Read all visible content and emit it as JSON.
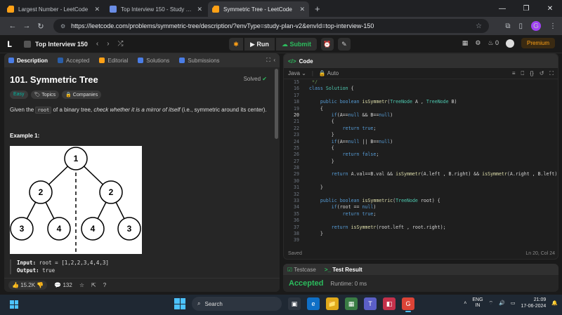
{
  "browser": {
    "tabs": [
      {
        "title": "Largest Number - LeetCode",
        "favicon": "leetcode-icon"
      },
      {
        "title": "Top Interview 150 - Study Plan",
        "favicon": "book-icon"
      },
      {
        "title": "Symmetric Tree - LeetCode",
        "favicon": "leetcode-icon",
        "active": true
      }
    ],
    "new_tab": "+",
    "url": "https://leetcode.com/problems/symmetric-tree/description/?envType=study-plan-v2&envId=top-interview-150",
    "profile_initial": "G"
  },
  "lc_nav": {
    "list_title": "Top Interview 150",
    "run_label": "Run",
    "submit_label": "Submit",
    "streak_count": "0",
    "premium_label": "Premium"
  },
  "left": {
    "tabs": [
      "Description",
      "Accepted",
      "Editorial",
      "Solutions",
      "Submissions"
    ],
    "title": "101. Symmetric Tree",
    "solved": "Solved",
    "tags": [
      "Easy",
      "Topics",
      "Companies"
    ],
    "desc_pre": "Given the ",
    "desc_code": "root",
    "desc_mid": " of a binary tree, ",
    "desc_em": "check whether it is a mirror of itself",
    "desc_post": " (i.e., symmetric around its center).",
    "example_title": "Example 1:",
    "tree_nodes": [
      "1",
      "2",
      "2",
      "3",
      "4",
      "4",
      "3"
    ],
    "input_label": "Input:",
    "input_value": "root = [1,2,2,3,4,4,3]",
    "output_label": "Output:",
    "output_value": "true",
    "likes": "15.2K",
    "comments": "132"
  },
  "right": {
    "header": "Code",
    "language": "Java",
    "mode": "Auto",
    "saved": "Saved",
    "cursor": "Ln 20, Col 24",
    "code_lines": [
      {
        "n": "15",
        "t": " */"
      },
      {
        "n": "16",
        "t": "class Solution {"
      },
      {
        "n": "17",
        "t": ""
      },
      {
        "n": "18",
        "t": "    public boolean isSymmetr(TreeNode A , TreeNode B)"
      },
      {
        "n": "19",
        "t": "    {"
      },
      {
        "n": "20",
        "t": "        if(A==null && B==null)"
      },
      {
        "n": "21",
        "t": "        {"
      },
      {
        "n": "22",
        "t": "            return true;"
      },
      {
        "n": "23",
        "t": "        }"
      },
      {
        "n": "24",
        "t": "        if(A==null || B==null)"
      },
      {
        "n": "25",
        "t": "        {"
      },
      {
        "n": "26",
        "t": "            return false;"
      },
      {
        "n": "27",
        "t": "        }"
      },
      {
        "n": "28",
        "t": ""
      },
      {
        "n": "29",
        "t": "        return A.val==B.val && isSymmetr(A.left , B.right) && isSymmetr(A.right , B.left);"
      },
      {
        "n": "30",
        "t": ""
      },
      {
        "n": "31",
        "t": "    }"
      },
      {
        "n": "32",
        "t": ""
      },
      {
        "n": "33",
        "t": "    public boolean isSymmetric(TreeNode root) {"
      },
      {
        "n": "34",
        "t": "        if(root == null)"
      },
      {
        "n": "35",
        "t": "            return true;"
      },
      {
        "n": "36",
        "t": ""
      },
      {
        "n": "37",
        "t": "        return isSymmetr(root.left , root.right);"
      },
      {
        "n": "38",
        "t": "    }"
      },
      {
        "n": "39",
        "t": ""
      }
    ]
  },
  "test": {
    "testcase_tab": "Testcase",
    "result_tab": "Test Result",
    "status": "Accepted",
    "runtime": "Runtime: 0 ms"
  },
  "taskbar": {
    "search_placeholder": "Search",
    "lang_top": "ENG",
    "lang_bottom": "IN",
    "time": "21:09",
    "date": "17-06-2024",
    "chrome_badge": "G"
  }
}
